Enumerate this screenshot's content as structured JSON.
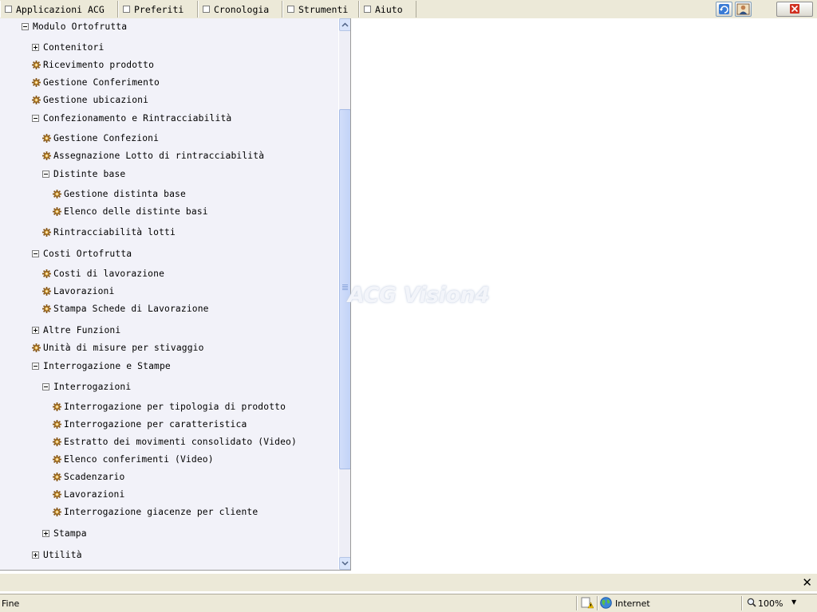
{
  "menu": {
    "items": [
      {
        "label": "Applicazioni ACG"
      },
      {
        "label": "Preferiti"
      },
      {
        "label": "Cronologia"
      },
      {
        "label": "Strumenti"
      },
      {
        "label": "Aiuto"
      }
    ]
  },
  "toolbar": {
    "refresh_icon": "refresh-icon",
    "user_icon": "user-icon",
    "close_icon": "close-icon",
    "close_color": "#d03020"
  },
  "tree": {
    "nodes": [
      {
        "label": "Modulo Ortofrutta",
        "kind": "folder",
        "state": "expanded"
      },
      {
        "label": "Contenitori",
        "kind": "folder",
        "state": "collapsed"
      },
      {
        "label": "Ricevimento prodotto",
        "kind": "item"
      },
      {
        "label": "Gestione Conferimento",
        "kind": "item"
      },
      {
        "label": "Gestione ubicazioni",
        "kind": "item"
      },
      {
        "label": "Confezionamento e Rintracciabilità",
        "kind": "folder",
        "state": "expanded"
      },
      {
        "label": "Gestione Confezioni",
        "kind": "item"
      },
      {
        "label": "Assegnazione Lotto di rintracciabilità",
        "kind": "item"
      },
      {
        "label": "Distinte base",
        "kind": "folder",
        "state": "expanded"
      },
      {
        "label": "Gestione distinta base",
        "kind": "item"
      },
      {
        "label": "Elenco delle distinte basi",
        "kind": "item"
      },
      {
        "label": "Rintracciabilità lotti",
        "kind": "item"
      },
      {
        "label": "Costi Ortofrutta",
        "kind": "folder",
        "state": "expanded"
      },
      {
        "label": "Costi di lavorazione",
        "kind": "item"
      },
      {
        "label": "Lavorazioni",
        "kind": "item"
      },
      {
        "label": "Stampa Schede di Lavorazione",
        "kind": "item"
      },
      {
        "label": "Altre Funzioni",
        "kind": "folder",
        "state": "collapsed"
      },
      {
        "label": "Unità di misure per stivaggio",
        "kind": "item"
      },
      {
        "label": "Interrogazione e Stampe",
        "kind": "folder",
        "state": "expanded"
      },
      {
        "label": "Interrogazioni",
        "kind": "folder",
        "state": "expanded"
      },
      {
        "label": "Interrogazione per tipologia di prodotto",
        "kind": "item"
      },
      {
        "label": "Interrogazione per caratteristica",
        "kind": "item"
      },
      {
        "label": "Estratto dei movimenti consolidato (Video)",
        "kind": "item"
      },
      {
        "label": "Elenco conferimenti (Video)",
        "kind": "item"
      },
      {
        "label": "Scadenzario",
        "kind": "item"
      },
      {
        "label": "Lavorazioni",
        "kind": "item"
      },
      {
        "label": "Interrogazione giacenze per cliente",
        "kind": "item"
      },
      {
        "label": "Stampa",
        "kind": "folder",
        "state": "collapsed"
      },
      {
        "label": "Utilità",
        "kind": "folder",
        "state": "collapsed"
      }
    ]
  },
  "watermark": {
    "text": "ACG Vision4"
  },
  "notification": {
    "close_glyph": "✕"
  },
  "statusbar": {
    "status": "Fine",
    "zone": "Internet",
    "zoom": "100%",
    "zoom_dropdown": "▼",
    "icons": [
      "security-warning-icon",
      "globe-icon",
      "zoom-icon"
    ]
  }
}
